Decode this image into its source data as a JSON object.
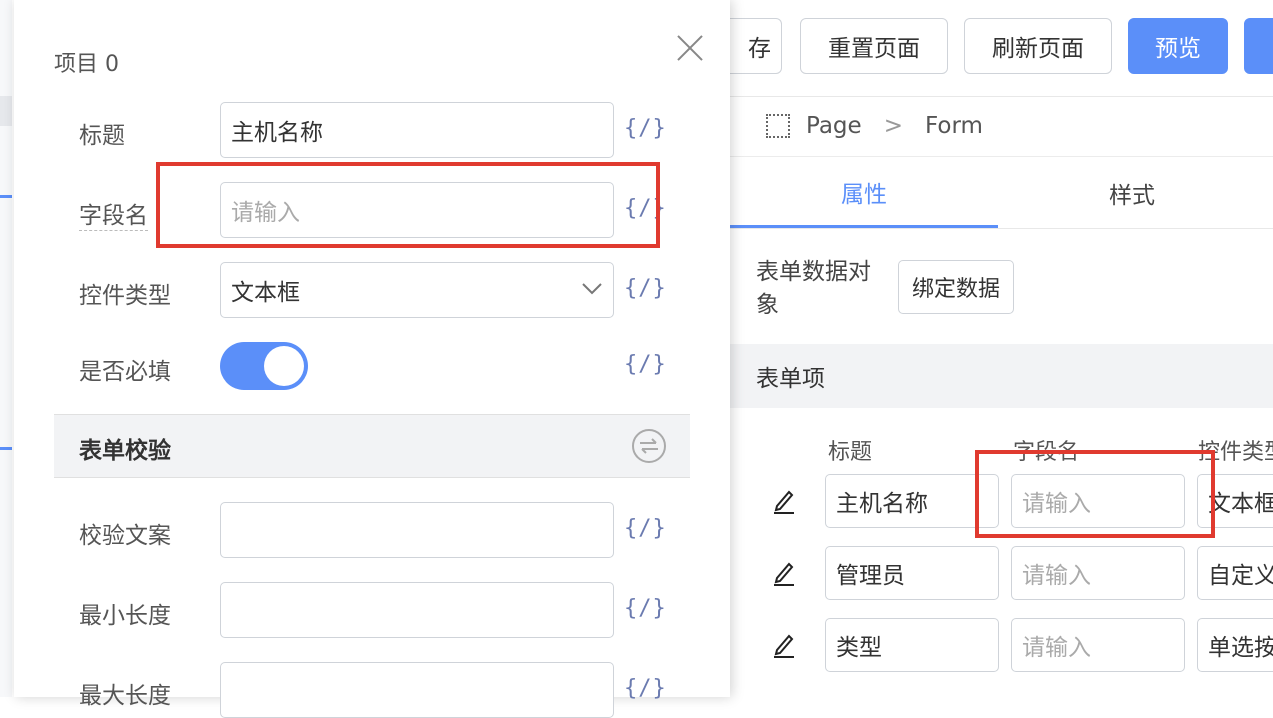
{
  "toolbar": {
    "save_label": "存",
    "reset_label": "重置页面",
    "refresh_label": "刷新页面",
    "preview_label": "预览"
  },
  "breadcrumb": {
    "page": "Page",
    "sep": ">",
    "form": "Form"
  },
  "tabs": {
    "props": "属性",
    "style": "样式"
  },
  "bind": {
    "label": "表单数据对象",
    "button": "绑定数据"
  },
  "form_items_section": "表单项",
  "grid": {
    "headers": [
      "标题",
      "字段名",
      "控件类型"
    ],
    "rows": [
      {
        "title": "主机名称",
        "field_placeholder": "请输入",
        "type": "文本框"
      },
      {
        "title": "管理员",
        "field_placeholder": "请输入",
        "type": "自定义"
      },
      {
        "title": "类型",
        "field_placeholder": "请输入",
        "type": "单选按钮"
      }
    ]
  },
  "drawer": {
    "title": "项目 0",
    "fields": {
      "title_label": "标题",
      "title_value": "主机名称",
      "field_label": "字段名",
      "field_placeholder": "请输入",
      "type_label": "控件类型",
      "type_value": "文本框",
      "required_label": "是否必填",
      "required_value": true
    },
    "validation": {
      "section_title": "表单校验",
      "message_label": "校验文案",
      "min_label": "最小长度",
      "max_label": "最大长度"
    },
    "code_icon_text": "{/}"
  },
  "colors": {
    "accent": "#5b8ff9",
    "highlight": "#e03a2f"
  }
}
